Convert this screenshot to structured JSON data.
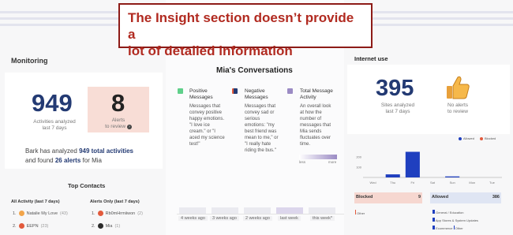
{
  "callout": {
    "line1": "The Insight section doesn’t provide a",
    "line2": "lot of detailed information"
  },
  "monitoring": {
    "title": "Monitoring",
    "activities_count": "949",
    "activities_label1": "Activities analyzed",
    "activities_label2": "last 7 days",
    "alerts_count": "8",
    "alerts_label1": "Alerts",
    "alerts_label2": "to review",
    "summary_pre": "Bark has analyzed",
    "summary_total": "949 total activities",
    "summary_mid": "and found",
    "summary_alerts": "26 alerts",
    "summary_post": "for Mia"
  },
  "top_contacts": {
    "title": "Top Contacts",
    "all_activity_header": "All Activity (last 7 days)",
    "alerts_only_header": "Alerts Only (last 7 days)",
    "all_activity": [
      {
        "rank": "1.",
        "name": "Natalie My Love",
        "count": "(43)",
        "color": "#f2a54a"
      },
      {
        "rank": "2.",
        "name": "EEPN",
        "count": "(23)",
        "color": "#e25a3c"
      }
    ],
    "alerts_only": [
      {
        "rank": "1.",
        "name": "Rb0mHrmiiwon",
        "count": "(2)",
        "color": "#e25a3c"
      },
      {
        "rank": "2.",
        "name": "Mia",
        "count": "(1)",
        "color": "#2b2b2b"
      }
    ]
  },
  "conversations": {
    "title": "Mia's Conversations",
    "legend": [
      {
        "title1": "Positive",
        "title2": "Messages",
        "color": "#5fd08a",
        "desc": [
          "Messages that",
          "convey positive",
          "happy emotions.",
          "\"I love ice",
          "cream.\" or \"I",
          "aced my science",
          "test!\""
        ]
      },
      {
        "title1": "Negative",
        "title2": "Messages",
        "color": "#233a73",
        "desc": [
          "Messages that",
          "convey sad or",
          "serious",
          "emotions: \"my",
          "best friend was",
          "mean to me,\" or",
          "\"I really hate",
          "riding the bus.\""
        ]
      },
      {
        "title1": "Total Message",
        "title2": "Activity",
        "color": "#9b8bc4",
        "desc": [
          "An overall look",
          "at how the",
          "number of",
          "messages that",
          "Mia sends",
          "fluctuates over",
          "time."
        ]
      }
    ],
    "scale_low": "less",
    "scale_high": "more",
    "weeks": [
      "4 weeks ago",
      "3 weeks ago",
      "2 weeks ago",
      "last week",
      "this week*"
    ]
  },
  "internet": {
    "title": "Internet use",
    "sites_count": "395",
    "sites_label1": "Sites analyzed",
    "sites_label2": "last 7 days",
    "alerts_label1": "No alerts",
    "alerts_label2": "to review",
    "legend_allowed": "Allowed",
    "legend_blocked": "Blocked",
    "blocked_label": "Blocked",
    "blocked_count": "9",
    "blocked_items": [
      "Other"
    ],
    "allowed_label": "Allowed",
    "allowed_count": "386",
    "allowed_items": [
      "General / Education",
      "App Stores & System Updates",
      "Ecommerce",
      "Other"
    ],
    "colors": {
      "allowed": "#1f3fbf",
      "blocked": "#e25a3c"
    }
  },
  "chart_data": {
    "type": "bar",
    "categories": [
      "Wed",
      "Thu",
      "Fri",
      "Sat",
      "Sun",
      "Mon",
      "Tue"
    ],
    "ylim": [
      0,
      300
    ],
    "yticks": [
      "200",
      "100"
    ],
    "series": [
      {
        "name": "Allowed",
        "values": [
          0,
          30,
          250,
          0,
          10,
          0,
          0
        ]
      },
      {
        "name": "Blocked",
        "values": [
          0,
          0,
          0,
          0,
          0,
          0,
          0
        ]
      }
    ]
  }
}
